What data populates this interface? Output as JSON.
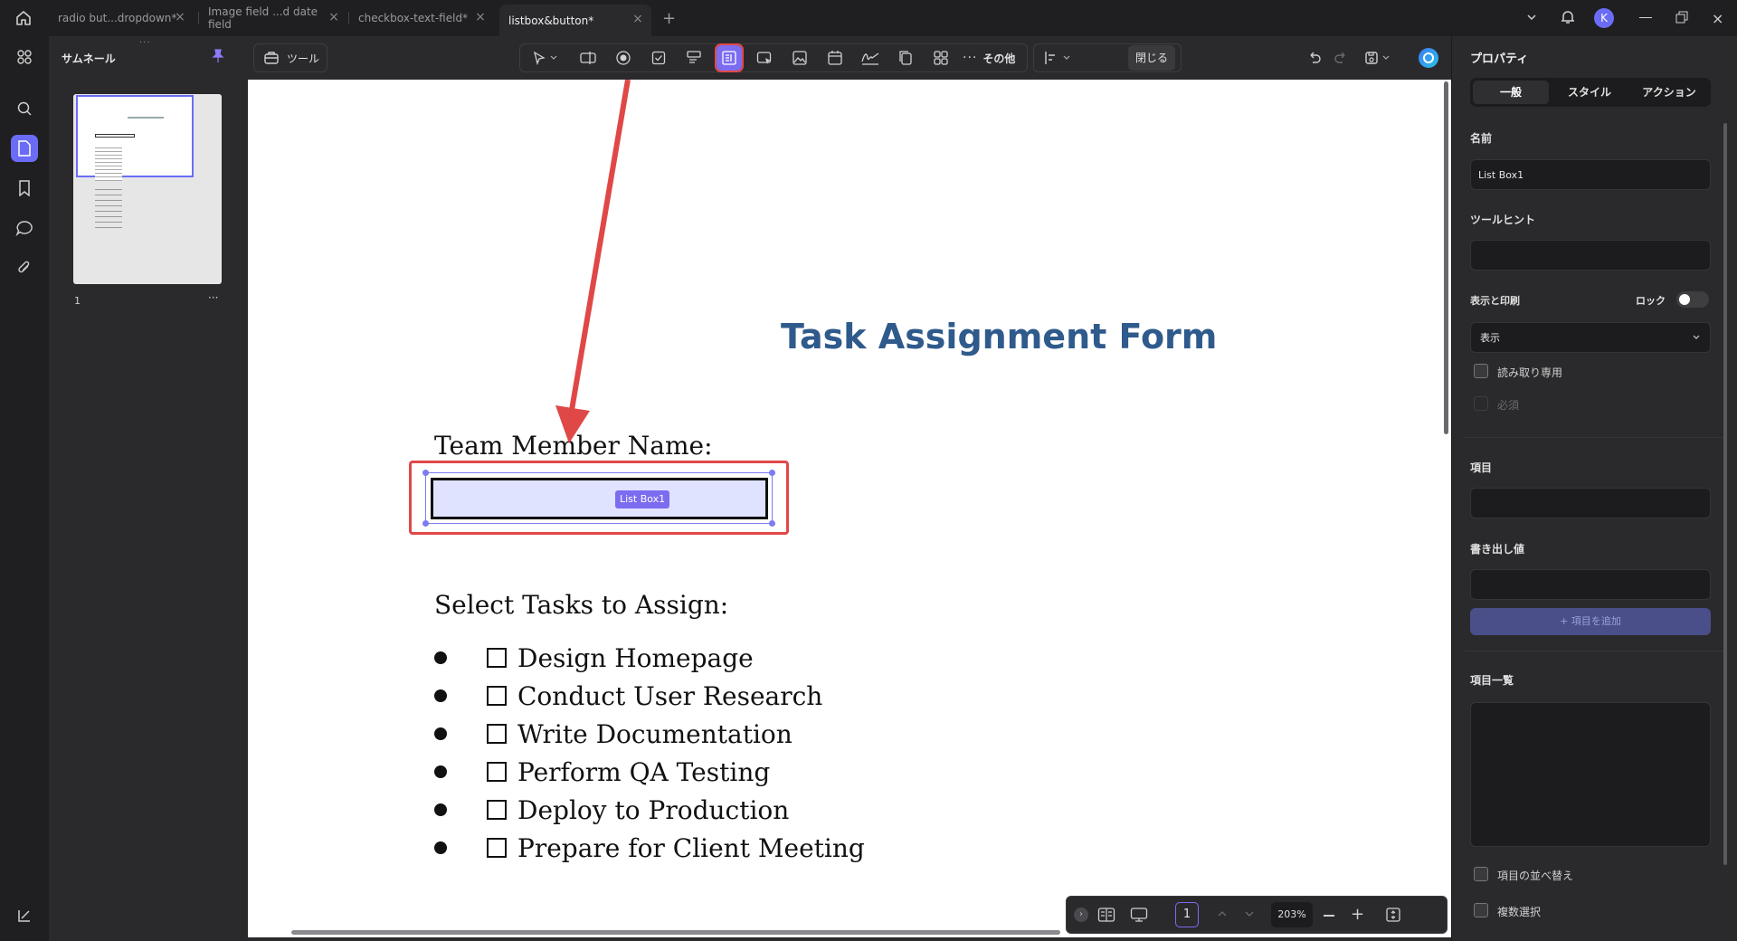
{
  "tabs": [
    {
      "label": "radio but...dropdown*",
      "active": false
    },
    {
      "label": "Image field ...d date field",
      "active": false
    },
    {
      "label": "checkbox-text-field*",
      "active": false
    },
    {
      "label": "listbox&button*",
      "active": true
    }
  ],
  "window": {
    "user_initial": "K"
  },
  "thumbnails": {
    "title": "サムネール",
    "page_number": "1",
    "more": "···"
  },
  "toolbar": {
    "tools_label": "ツール",
    "more_label": "その他",
    "close_label": "閉じる"
  },
  "document": {
    "title": "Task Assignment Form",
    "team_member_label": "Team Member Name:",
    "listbox_tag": "List Box1",
    "select_tasks_label": "Select Tasks to Assign:",
    "tasks": [
      "Design Homepage",
      "Conduct User Research",
      "Write Documentation",
      "Perform QA Testing",
      "Deploy to Production",
      "Prepare for Client Meeting"
    ]
  },
  "properties": {
    "header": "プロパティ",
    "tabs": [
      "一般",
      "スタイル",
      "アクション"
    ],
    "active_tab": "一般",
    "name_label": "名前",
    "name_value": "List Box1",
    "tooltip_label": "ツールヒント",
    "tooltip_value": "",
    "display_print_label": "表示と印刷",
    "lock_label": "ロック",
    "lock_on": false,
    "display_value": "表示",
    "readonly_label": "読み取り専用",
    "required_label": "必須",
    "item_label": "項目",
    "export_value_label": "書き出し値",
    "add_item_button": "+ 項目を追加",
    "item_list_label": "項目一覧",
    "sort_items_label": "項目の並べ替え",
    "multi_select_label": "複数選択"
  },
  "statusbar": {
    "page": "1",
    "zoom": "203%"
  },
  "colors": {
    "accent": "#6b6cf6",
    "highlight": "#e04848",
    "title_blue": "#2f5a8c"
  }
}
